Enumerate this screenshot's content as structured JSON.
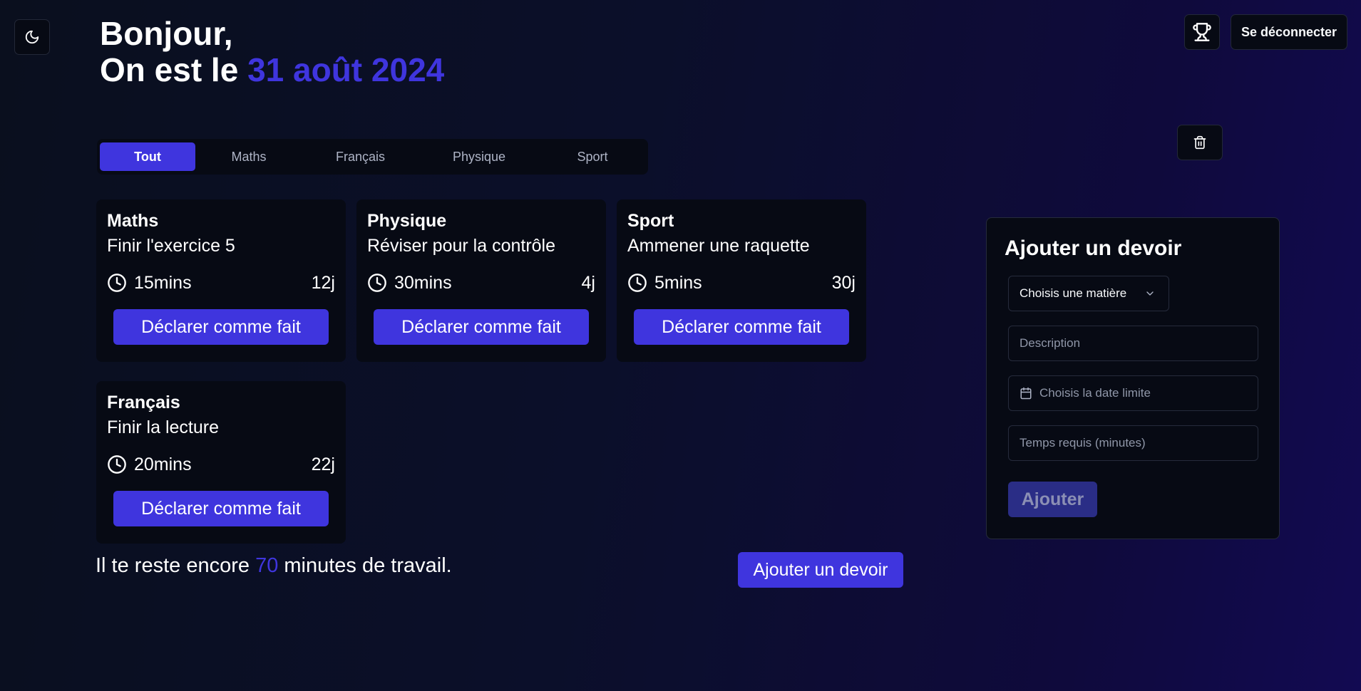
{
  "header": {
    "greeting_line1": "Bonjour,",
    "greeting_prefix": "On est le",
    "date": "31 août 2024",
    "logout_label": "Se déconnecter"
  },
  "tabs": [
    {
      "label": "Tout",
      "active": true
    },
    {
      "label": "Maths",
      "active": false
    },
    {
      "label": "Français",
      "active": false
    },
    {
      "label": "Physique",
      "active": false
    },
    {
      "label": "Sport",
      "active": false
    }
  ],
  "tasks": [
    {
      "subject": "Maths",
      "description": "Finir l'exercice 5",
      "time": "15mins",
      "days": "12j",
      "button_label": "Déclarer comme fait"
    },
    {
      "subject": "Physique",
      "description": "Réviser pour la contrôle",
      "time": "30mins",
      "days": "4j",
      "button_label": "Déclarer comme fait"
    },
    {
      "subject": "Sport",
      "description": "Ammener une raquette",
      "time": "5mins",
      "days": "30j",
      "button_label": "Déclarer comme fait"
    },
    {
      "subject": "Français",
      "description": "Finir la lecture",
      "time": "20mins",
      "days": "22j",
      "button_label": "Déclarer comme fait"
    }
  ],
  "summary": {
    "prefix": "Il te reste encore",
    "minutes": "70",
    "suffix": "minutes de travail."
  },
  "add_task_button": "Ajouter un devoir",
  "form": {
    "title": "Ajouter un devoir",
    "subject_placeholder": "Choisis une matière",
    "description_placeholder": "Description",
    "date_placeholder": "Choisis la date limite",
    "time_placeholder": "Temps requis (minutes)",
    "submit_label": "Ajouter"
  },
  "icons": {
    "theme": "moon-icon",
    "trophy": "trophy-icon",
    "trash": "trash-icon",
    "clock": "clock-icon",
    "calendar": "calendar-icon",
    "chevron": "chevron-down-icon"
  },
  "colors": {
    "accent": "#3f35de",
    "card_bg": "#070a14",
    "submit_disabled": "#2a2d86"
  }
}
